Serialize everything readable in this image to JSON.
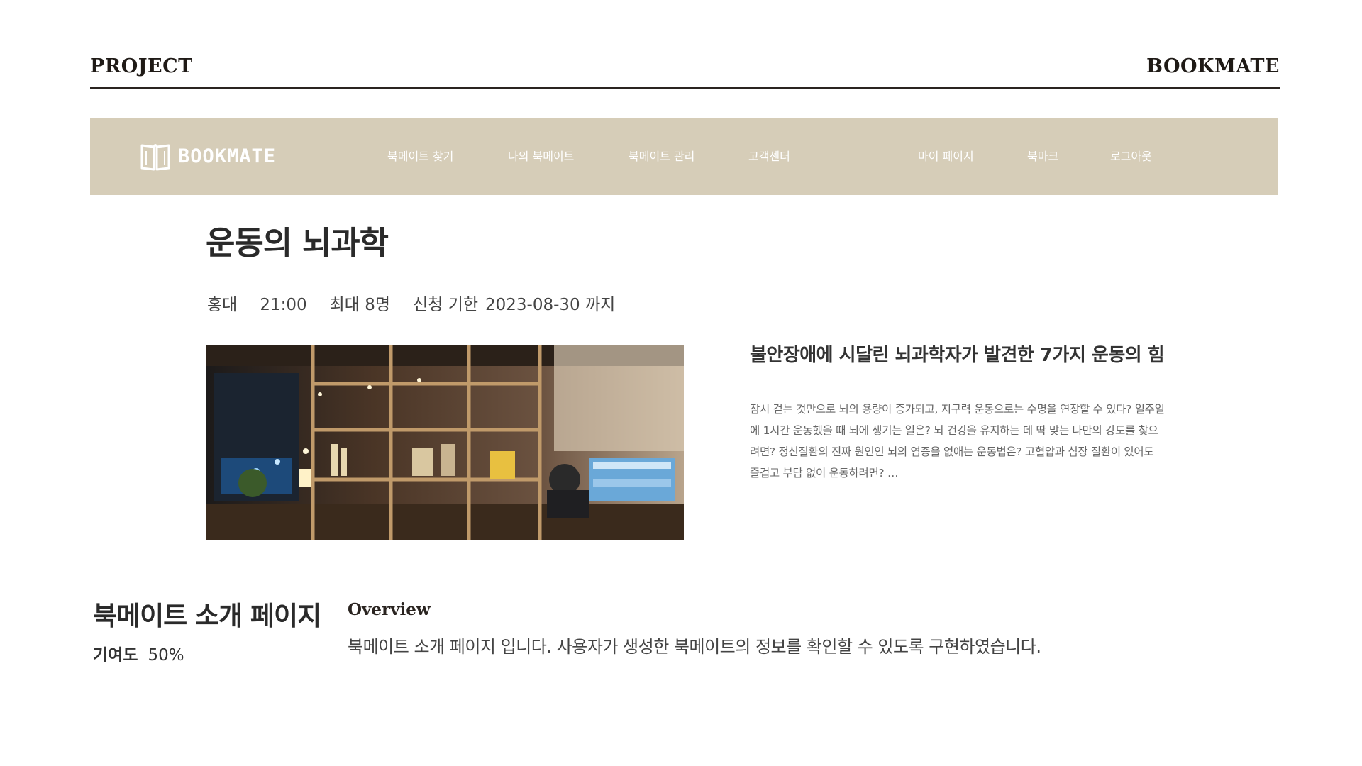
{
  "frame": {
    "left_label": "PROJECT",
    "right_label": "BOOKMATE"
  },
  "navbar": {
    "logo_text": "BOOKMATE",
    "items": [
      {
        "label": "북메이트 찾기"
      },
      {
        "label": "나의 북메이트"
      },
      {
        "label": "북메이트 관리"
      },
      {
        "label": "고객센터"
      },
      {
        "label": "마이 페이지"
      },
      {
        "label": "북마크"
      },
      {
        "label": "로그아웃"
      }
    ],
    "background": "#d6cdb8"
  },
  "detail": {
    "title": "운동의 뇌과학",
    "location": "홍대",
    "time": "21:00",
    "capacity": "최대 8명",
    "deadline_label": "신청 기한",
    "deadline": "2023-08-30 까지",
    "article_title": "불안장애에 시달린 뇌과학자가 발견한 7가지 운동의 힘",
    "article_body": "잠시 걷는 것만으로 뇌의 용량이 증가되고, 지구력 운동으로는 수명을 연장할 수 있다? 일주일에 1시간 운동했을 때 뇌에 생기는 일은? 뇌 건강을 유지하는 데 딱 맞는 나만의 강도를 찾으려면? 정신질환의 진짜 원인인 뇌의 염증을 없애는 운동법은? 고혈압과 심장 질환이 있어도 즐겁고 부담 없이 운동하려면? …"
  },
  "intro": {
    "title": "북메이트 소개 페이지",
    "contribution_label": "기여도",
    "contribution_value": "50%",
    "overview_heading": "Overview",
    "overview_text": "북메이트 소개 페이지 입니다. 사용자가 생성한 북메이트의 정보를 확인할 수 있도록 구현하였습니다."
  }
}
